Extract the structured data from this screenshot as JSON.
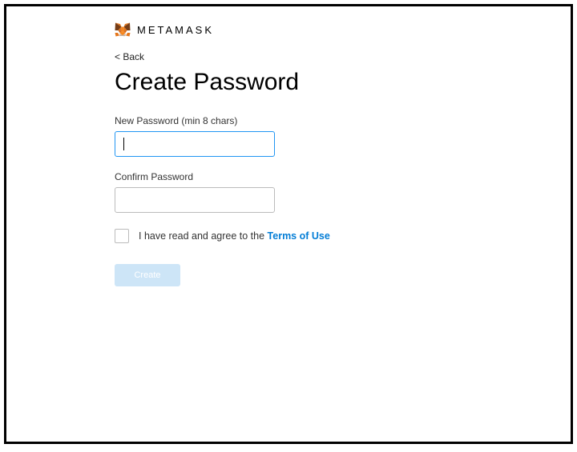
{
  "header": {
    "brand": "METAMASK"
  },
  "nav": {
    "back": "< Back"
  },
  "page": {
    "title": "Create Password"
  },
  "form": {
    "new_password": {
      "label": "New Password (min 8 chars)",
      "value": ""
    },
    "confirm_password": {
      "label": "Confirm Password",
      "value": ""
    },
    "agree": {
      "prefix": "I have read and agree to the ",
      "link": "Terms of Use"
    },
    "create_label": "Create"
  },
  "colors": {
    "accent": "#037dd6",
    "focus_border": "#2196f3",
    "disabled_btn": "#cde5f7"
  }
}
